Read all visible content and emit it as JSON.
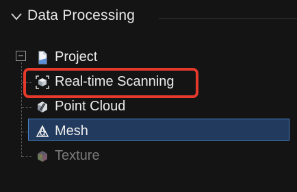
{
  "panel": {
    "title": "Data Processing",
    "expander_icon": "chevron-down-icon"
  },
  "tree": {
    "root": {
      "label": "Project",
      "icon": "document-icon",
      "expanded": true
    },
    "children": [
      {
        "label": "Real-time Scanning",
        "icon": "scan-icon",
        "state": "highlighted"
      },
      {
        "label": "Point Cloud",
        "icon": "point-cloud-icon",
        "state": "normal"
      },
      {
        "label": "Mesh",
        "icon": "mesh-icon",
        "state": "selected"
      },
      {
        "label": "Texture",
        "icon": "texture-icon",
        "state": "disabled"
      }
    ]
  },
  "colors": {
    "background": "#141414",
    "selection_fill": "#213a5e",
    "selection_border": "#4a86cf",
    "highlight_annotation": "#e5392b",
    "disabled_text": "#7a7a7a"
  }
}
